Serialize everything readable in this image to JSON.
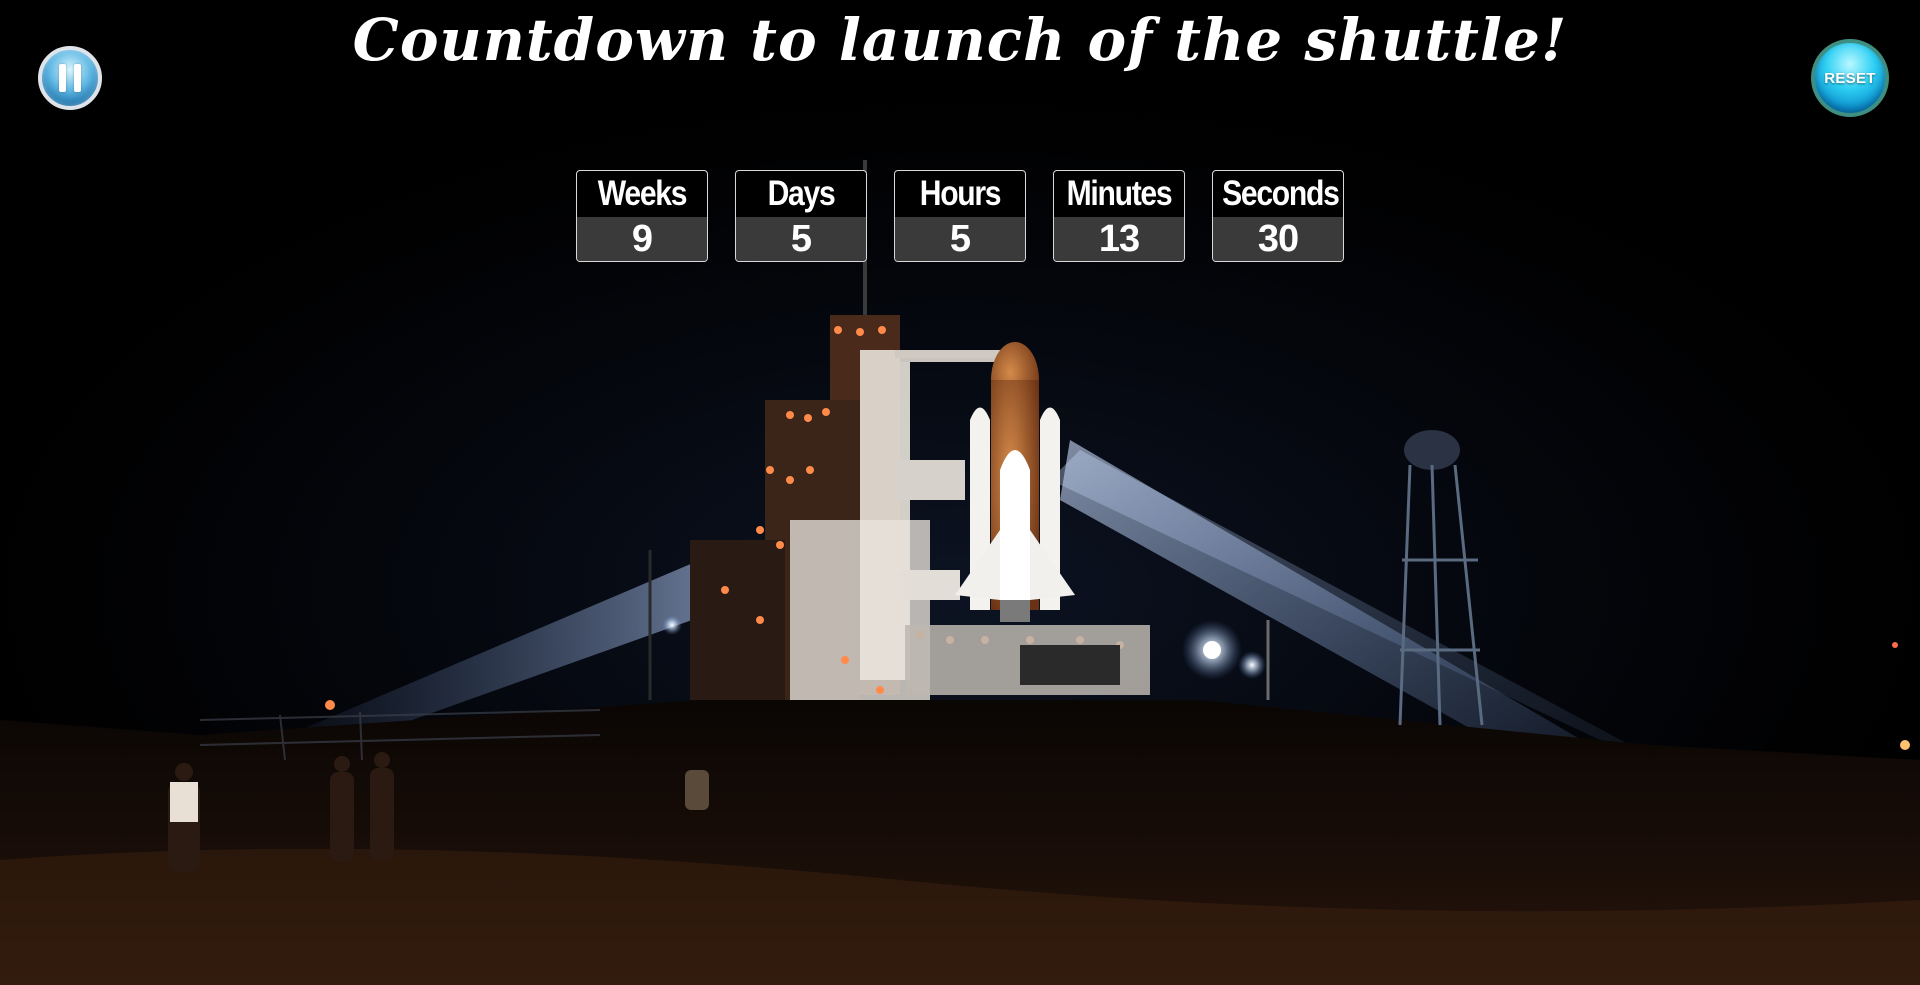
{
  "page": {
    "title": "Countdown to launch of the shuttle!"
  },
  "controls": {
    "pause_icon": "pause-icon",
    "reset_label": "RESET"
  },
  "countdown": [
    {
      "label": "Weeks",
      "value": "9"
    },
    {
      "label": "Days",
      "value": "5"
    },
    {
      "label": "Hours",
      "value": "5"
    },
    {
      "label": "Minutes",
      "value": "13"
    },
    {
      "label": "Seconds",
      "value": "30"
    }
  ],
  "colors": {
    "background": "#000000",
    "counter_value_bg": "#3a3a3a",
    "reset_button": "#2fd0f4",
    "pause_button": "#5fb7e3"
  }
}
